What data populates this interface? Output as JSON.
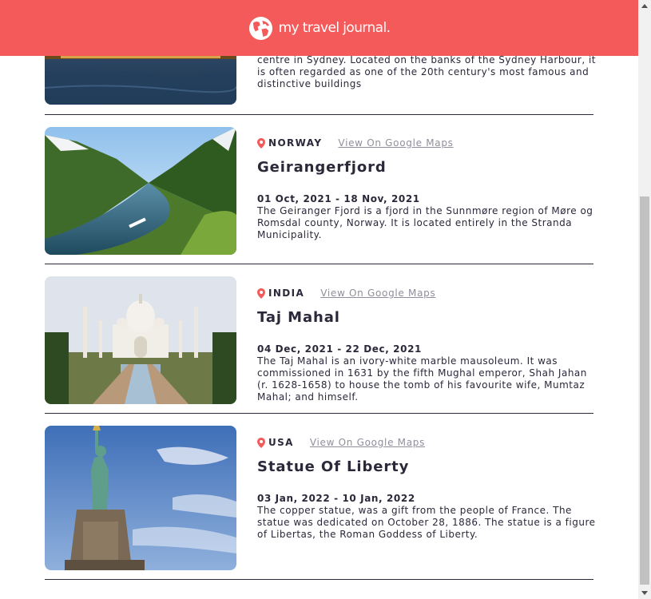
{
  "header": {
    "title": "my travel journal.",
    "brand_color": "#F55A5A",
    "logo_icon": "globe-icon"
  },
  "entries": [
    {
      "country": "",
      "map_link": "",
      "place": "",
      "dates": "",
      "description": "centre in Sydney. Located on the banks of the Sydney Harbour, it is often regarded as one of the 20th century's most famous and distinctive buildings",
      "image_icon": "sydney-opera-house-photo"
    },
    {
      "country": "NORWAY",
      "map_link": "View On Google Maps",
      "place": "Geirangerfjord",
      "dates": "01 Oct, 2021 - 18 Nov, 2021",
      "description": "The Geiranger Fjord is a fjord in the Sunnmøre region of Møre og Romsdal county, Norway. It is located entirely in the Stranda Municipality.",
      "image_icon": "geirangerfjord-photo"
    },
    {
      "country": "INDIA",
      "map_link": "View On Google Maps",
      "place": "Taj Mahal",
      "dates": "04 Dec, 2021 - 22 Dec, 2021",
      "description": "The Taj Mahal is an ivory-white marble mausoleum. It was commissioned in 1631 by the fifth Mughal emperor, Shah Jahan (r. 1628-1658) to house the tomb of his favourite wife, Mumtaz Mahal; and himself.",
      "image_icon": "taj-mahal-photo"
    },
    {
      "country": "USA",
      "map_link": "View On Google Maps",
      "place": "Statue Of Liberty",
      "dates": "03 Jan, 2022 - 10 Jan, 2022",
      "description": "The copper statue, was a gift from the people of France. The statue was dedicated on October 28, 1886. The statue is a figure of Libertas, the Roman Goddess of Liberty.",
      "image_icon": "statue-of-liberty-photo"
    }
  ]
}
